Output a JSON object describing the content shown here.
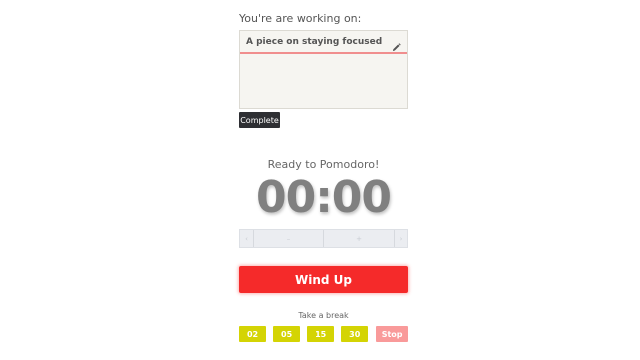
{
  "task": {
    "heading": "You're are working on:",
    "title": "A piece on staying focused",
    "complete_label": "Complete"
  },
  "timer": {
    "status": "Ready to Pomodoro!",
    "display": "00:00",
    "adjust_controls": {
      "far_left": "‹",
      "decrease": "–",
      "increase": "+",
      "far_right": "›"
    }
  },
  "actions": {
    "windup_label": "Wind Up"
  },
  "breaks": {
    "label": "Take a break",
    "options": [
      "02",
      "05",
      "15",
      "30"
    ],
    "stop_label": "Stop"
  },
  "colors": {
    "accent_red": "#f52a2a",
    "break_yellow": "#d4d404",
    "stop_pink": "#f99a9a",
    "complete_dark": "#2e2f33"
  }
}
